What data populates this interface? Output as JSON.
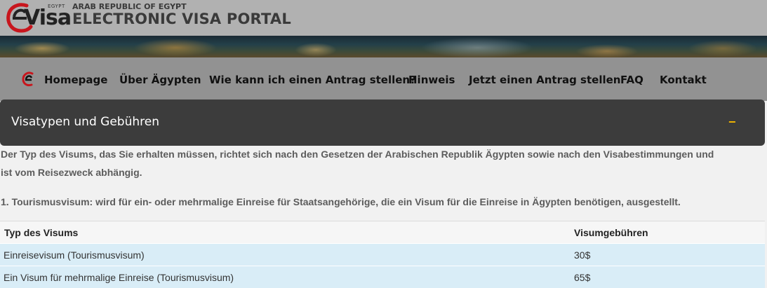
{
  "header": {
    "logo_small": "EGYPT",
    "logo_word": "Visa",
    "subtitle": "ARAB REPUBLIC OF EGYPT",
    "title": "ELECTRONIC VISA PORTAL"
  },
  "nav": {
    "items": [
      {
        "label": "Homepage"
      },
      {
        "label": "Über Ägypten"
      },
      {
        "label": "Wie kann ich einen Antrag stellen?"
      },
      {
        "label": "Hinweis"
      },
      {
        "label": "Jetzt einen Antrag stellen"
      },
      {
        "label": "FAQ"
      },
      {
        "label": "Kontakt"
      }
    ]
  },
  "panel": {
    "title": "Visatypen und Gebühren",
    "toggle": "−"
  },
  "content": {
    "intro_line1": "Der Typ des Visums, das Sie erhalten müssen, richtet sich nach den Gesetzen der Arabischen Republik Ägypten sowie nach den Visabestimmungen und",
    "intro_line2": "ist vom Reisezweck abhängig.",
    "tourism": "1. Tourismusvisum: wird für ein- oder mehrmalige Einreise für Staatsangehörige, die ein Visum für die Einreise in Ägypten benötigen, ausgestellt."
  },
  "table": {
    "headers": [
      "Typ des Visums",
      "Visumgebühren"
    ],
    "rows": [
      [
        "Einreisevisum (Tourismusvisum)",
        "30$"
      ],
      [
        "Ein Visum für mehrmalige Einreise (Tourismusvisum)",
        "65$"
      ]
    ]
  },
  "colors": {
    "header_bg": "#b1b1b1",
    "nav_bg": "#929292",
    "panel_bg": "#3c3c3c",
    "accent": "#f0b400",
    "row_highlight": "#d9edf7",
    "logo_red": "#c8161d"
  }
}
